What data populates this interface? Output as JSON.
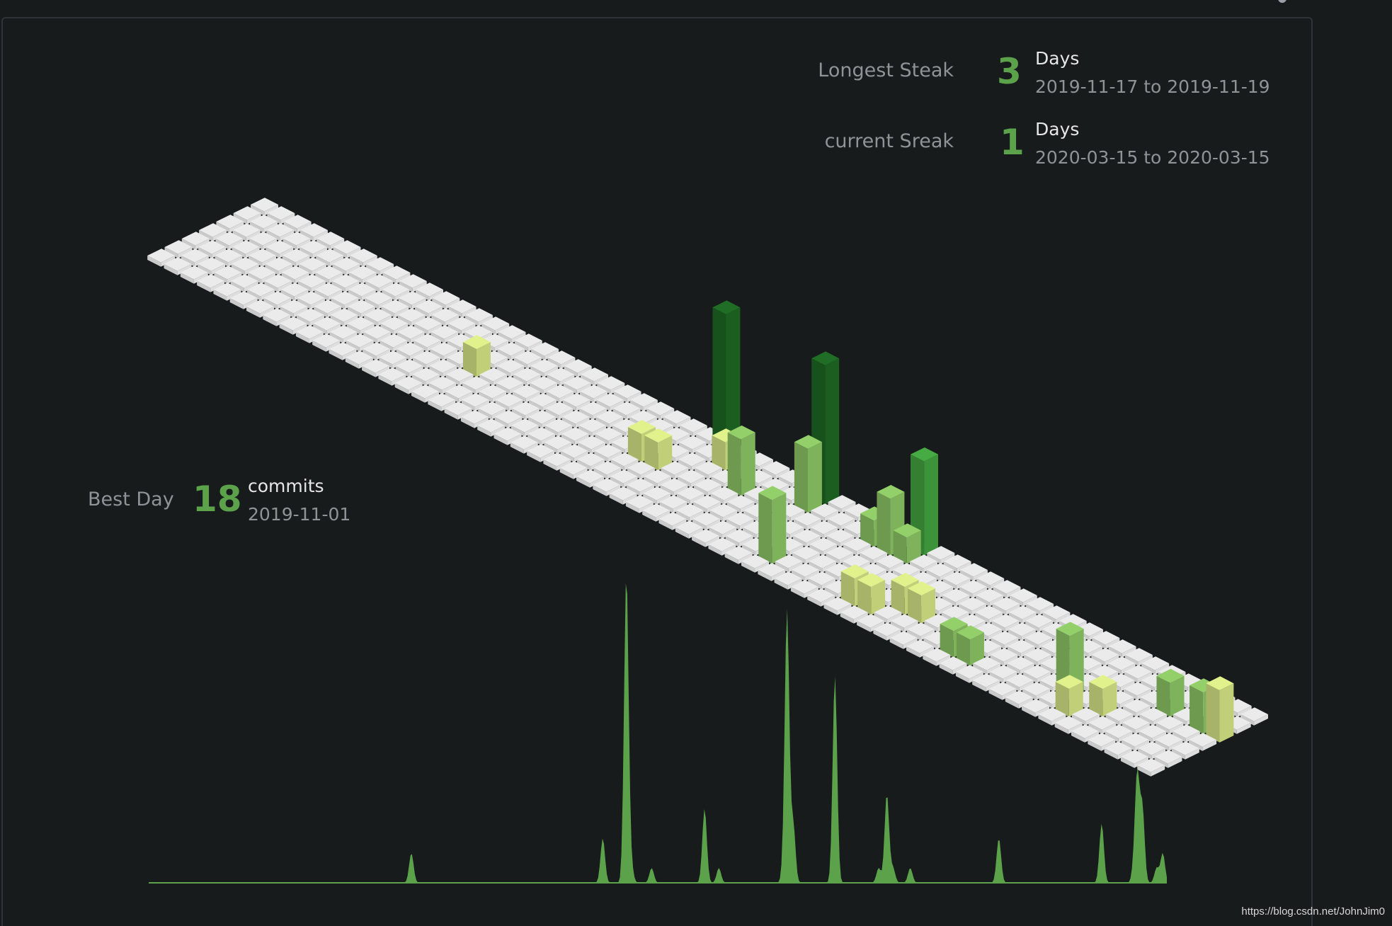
{
  "stats": {
    "longest_streak": {
      "label": "Longest Steak",
      "value": "3",
      "unit": "Days",
      "range": "2019-11-17 to 2019-11-19"
    },
    "current_streak": {
      "label": "current Sreak",
      "value": "1",
      "unit": "Days",
      "range": "2020-03-15 to 2020-03-15"
    },
    "best_day": {
      "label": "Best Day",
      "value": "18",
      "unit": "commits",
      "date": "2019-11-01"
    }
  },
  "watermark": "https://blog.csdn.net/JohnJim0",
  "colors": {
    "background": "#181b1c",
    "tile_empty": "#ebebeb",
    "level1": "#d6e685",
    "level2": "#8cc665",
    "level3": "#44a340",
    "level4": "#1e6823",
    "accent_number": "#5ba24a",
    "sparkline": "#5ba24a"
  },
  "chart_data": {
    "type": "isometric-bar",
    "grid": {
      "weeks": 61,
      "days_per_week": 7
    },
    "commits": [
      {
        "week": 16,
        "day": 3,
        "value": 1
      },
      {
        "week": 26,
        "day": 3,
        "value": 1
      },
      {
        "week": 27,
        "day": 3,
        "value": 1
      },
      {
        "week": 28,
        "day": 0,
        "value": 18
      },
      {
        "week": 29,
        "day": 1,
        "value": 1
      },
      {
        "week": 31,
        "day": 2,
        "value": 7
      },
      {
        "week": 34,
        "day": 0,
        "value": 18
      },
      {
        "week": 34,
        "day": 1,
        "value": 8
      },
      {
        "week": 36,
        "day": 5,
        "value": 8
      },
      {
        "week": 38,
        "day": 1,
        "value": 3
      },
      {
        "week": 39,
        "day": 1,
        "value": 7
      },
      {
        "week": 40,
        "day": 0,
        "value": 12
      },
      {
        "week": 40,
        "day": 1,
        "value": 3
      },
      {
        "week": 41,
        "day": 5,
        "value": 1
      },
      {
        "week": 42,
        "day": 5,
        "value": 1
      },
      {
        "week": 43,
        "day": 4,
        "value": 1
      },
      {
        "week": 44,
        "day": 4,
        "value": 1
      },
      {
        "week": 47,
        "day": 5,
        "value": 3
      },
      {
        "week": 48,
        "day": 5,
        "value": 3
      },
      {
        "week": 53,
        "day": 4,
        "value": 8
      },
      {
        "week": 54,
        "day": 5,
        "value": 1
      },
      {
        "week": 55,
        "day": 4,
        "value": 1
      },
      {
        "week": 57,
        "day": 2,
        "value": 4
      },
      {
        "week": 59,
        "day": 2,
        "value": 5
      },
      {
        "week": 60,
        "day": 2,
        "value": 2
      }
    ]
  },
  "sparkline_data": {
    "type": "area",
    "peaks": [
      {
        "x": 0.258,
        "value": 2
      },
      {
        "x": 0.446,
        "value": 3
      },
      {
        "x": 0.469,
        "value": 18
      },
      {
        "x": 0.47,
        "value": 3
      },
      {
        "x": 0.474,
        "value": 1
      },
      {
        "x": 0.494,
        "value": 1
      },
      {
        "x": 0.546,
        "value": 5
      },
      {
        "x": 0.56,
        "value": 1
      },
      {
        "x": 0.624,
        "value": 1
      },
      {
        "x": 0.627,
        "value": 18
      },
      {
        "x": 0.633,
        "value": 4
      },
      {
        "x": 0.674,
        "value": 14
      },
      {
        "x": 0.717,
        "value": 1
      },
      {
        "x": 0.725,
        "value": 6
      },
      {
        "x": 0.731,
        "value": 1
      },
      {
        "x": 0.748,
        "value": 1
      },
      {
        "x": 0.835,
        "value": 3
      },
      {
        "x": 0.936,
        "value": 4
      },
      {
        "x": 0.968,
        "value": 1
      },
      {
        "x": 0.971,
        "value": 7
      },
      {
        "x": 0.976,
        "value": 5
      },
      {
        "x": 0.99,
        "value": 1
      },
      {
        "x": 0.996,
        "value": 2
      }
    ]
  }
}
